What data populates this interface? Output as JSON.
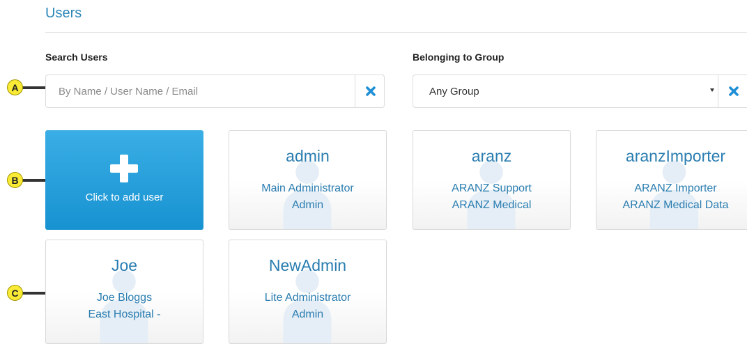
{
  "header": {
    "title": "Users"
  },
  "search": {
    "label": "Search Users",
    "placeholder": "By Name / User Name / Email",
    "value": ""
  },
  "group_filter": {
    "label": "Belonging to Group",
    "selected": "Any Group"
  },
  "add_user": {
    "label": "Click to add user"
  },
  "users": [
    {
      "username": "admin",
      "full_name": "Main Administrator",
      "group": "Admin"
    },
    {
      "username": "aranz",
      "full_name": "ARANZ Support",
      "group": "ARANZ Medical"
    },
    {
      "username": "aranzImporter",
      "full_name": "ARANZ Importer",
      "group": "ARANZ Medical Data"
    },
    {
      "username": "Joe",
      "full_name": "Joe Bloggs",
      "group": "East Hospital -"
    },
    {
      "username": "NewAdmin",
      "full_name": "Lite Administrator",
      "group": "Admin"
    }
  ],
  "annotations": [
    "A",
    "B",
    "C"
  ],
  "colors": {
    "accent": "#2a87b8",
    "add_button": "#1f9bd9",
    "clear_icon": "#1e8fd6",
    "marker": "#f8ea35"
  },
  "icons": {
    "clear": "close-icon",
    "add": "plus-icon",
    "avatar": "user-silhouette-icon",
    "dropdown": "caret-down-icon"
  }
}
